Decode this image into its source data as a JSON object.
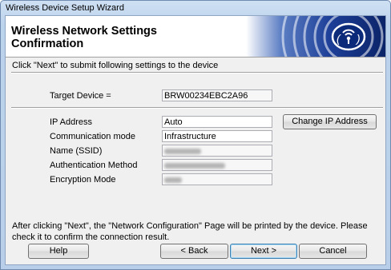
{
  "window": {
    "title": "Wireless Device Setup Wizard"
  },
  "banner": {
    "heading": "Wireless Network Settings\nConfirmation",
    "logo_icon": "wireless-signal-icon"
  },
  "instruction": "Click \"Next\" to submit following settings to the device",
  "target": {
    "label": "Target Device =",
    "value": "BRW00234EBC2A96"
  },
  "settings": [
    {
      "label": "IP Address",
      "value": "Auto",
      "redacted": false
    },
    {
      "label": "Communication mode",
      "value": "Infrastructure",
      "redacted": false
    },
    {
      "label": "Name (SSID)",
      "value": "",
      "redacted": true
    },
    {
      "label": "Authentication Method",
      "value": "",
      "redacted": true
    },
    {
      "label": "Encryption Mode",
      "value": "",
      "redacted": true
    }
  ],
  "change_ip_button": "Change IP Address",
  "note": "After clicking \"Next\", the \"Network Configuration\" Page will be printed by the device. Please check it to confirm the connection result.",
  "buttons": {
    "help": "Help",
    "back": "< Back",
    "next": "Next >",
    "cancel": "Cancel"
  },
  "colors": {
    "banner_blue": "#1b3a8c",
    "title_bar": "#c6daf1"
  }
}
